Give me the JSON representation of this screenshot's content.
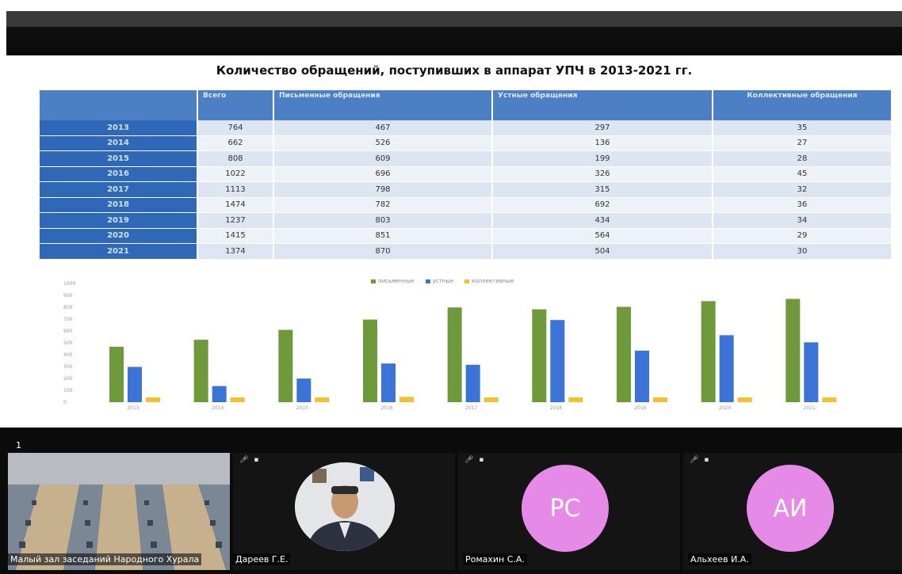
{
  "slide": {
    "title": "Количество обращений, поступивших в аппарат УПЧ в 2013-2021 гг.",
    "table": {
      "headers": [
        "",
        "Всего",
        "Письменные обращения",
        "Устные обращения",
        "Коллективные обращения"
      ],
      "rows": [
        {
          "year": "2013",
          "total": "764",
          "written": "467",
          "oral": "297",
          "collective": "35"
        },
        {
          "year": "2014",
          "total": "662",
          "written": "526",
          "oral": "136",
          "collective": "27"
        },
        {
          "year": "2015",
          "total": "808",
          "written": "609",
          "oral": "199",
          "collective": "28"
        },
        {
          "year": "2016",
          "total": "1022",
          "written": "696",
          "oral": "326",
          "collective": "45"
        },
        {
          "year": "2017",
          "total": "1113",
          "written": "798",
          "oral": "315",
          "collective": "32"
        },
        {
          "year": "2018",
          "total": "1474",
          "written": "782",
          "oral": "692",
          "collective": "36"
        },
        {
          "year": "2019",
          "total": "1237",
          "written": "803",
          "oral": "434",
          "collective": "34"
        },
        {
          "year": "2020",
          "total": "1415",
          "written": "851",
          "oral": "564",
          "collective": "29"
        },
        {
          "year": "2021",
          "total": "1374",
          "written": "870",
          "oral": "504",
          "collective": "30"
        }
      ]
    }
  },
  "chart_data": {
    "type": "bar",
    "categories": [
      "2013",
      "2014",
      "2015",
      "2016",
      "2017",
      "2018",
      "2019",
      "2020",
      "2021"
    ],
    "series": [
      {
        "name": "письменные",
        "color": "#6f9a3c",
        "values": [
          467,
          526,
          609,
          696,
          798,
          782,
          803,
          851,
          870
        ]
      },
      {
        "name": "устные",
        "color": "#3b73d6",
        "values": [
          297,
          136,
          199,
          326,
          315,
          692,
          434,
          564,
          504
        ]
      },
      {
        "name": "коллективные",
        "color": "#f2c12e",
        "values": [
          35,
          27,
          28,
          45,
          32,
          36,
          34,
          29,
          30
        ]
      }
    ],
    "yticks": [
      "0",
      "100",
      "200",
      "300",
      "400",
      "500",
      "600",
      "700",
      "800",
      "900",
      "1000"
    ],
    "ylim": [
      0,
      1000
    ],
    "legend_position": "top-center"
  },
  "conference": {
    "page_number": "1",
    "participants": [
      {
        "name": "Малый зал заседаний Народного Хурала",
        "kind": "video-room"
      },
      {
        "name": "Дареев Г.Е.",
        "kind": "video-person"
      },
      {
        "name": "Ромахин С.А.",
        "initials": "РС",
        "color": "#e68ae8"
      },
      {
        "name": "Альхеев И.А.",
        "initials": "АИ",
        "color": "#e68ae8"
      }
    ]
  }
}
